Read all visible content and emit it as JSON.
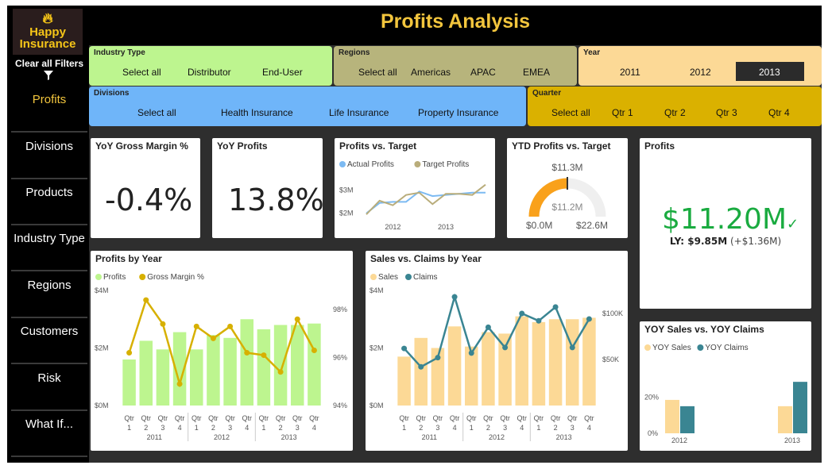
{
  "header": {
    "title": "Profits Analysis"
  },
  "sidebar": {
    "logo_line1": "Happy",
    "logo_line2": "Insurance",
    "clear_filters": "Clear all Filters",
    "items": [
      {
        "label": "Profits"
      },
      {
        "label": "Divisions"
      },
      {
        "label": "Products"
      },
      {
        "label": "Industry Type"
      },
      {
        "label": "Regions"
      },
      {
        "label": "Customers"
      },
      {
        "label": "Risk"
      },
      {
        "label": "What If..."
      }
    ]
  },
  "slicers": {
    "industry": {
      "label": "Industry Type",
      "options": [
        "Select all",
        "Distributor",
        "End-User"
      ]
    },
    "regions": {
      "label": "Regions",
      "options": [
        "Select all",
        "Americas",
        "APAC",
        "EMEA"
      ]
    },
    "year": {
      "label": "Year",
      "options": [
        "2011",
        "2012",
        "2013"
      ],
      "selected": "2013"
    },
    "divisions": {
      "label": "Divisions",
      "options": [
        "Select all",
        "Health Insurance",
        "Life Insurance",
        "Property Insurance"
      ]
    },
    "quarter": {
      "label": "Quarter",
      "options": [
        "Select all",
        "Qtr 1",
        "Qtr 2",
        "Qtr 3",
        "Qtr 4"
      ]
    }
  },
  "kpis": {
    "yoy_gross_margin": {
      "title": "YoY Gross Margin %",
      "value": "-0.4%"
    },
    "yoy_profits": {
      "title": "YoY Profits",
      "value": "13.8%"
    }
  },
  "profits_card": {
    "title": "Profits",
    "value": "$11.20M",
    "ly_label": "LY: $9.85M",
    "ly_delta": "(+$1.36M)"
  },
  "ytd_gauge": {
    "title": "YTD Profits vs. Target",
    "target_label": "$11.3M",
    "value_label": "$11.2M",
    "min_label": "$0.0M",
    "max_label": "$22.6M",
    "value": 11.2,
    "max": 22.6,
    "target": 11.3
  },
  "colors": {
    "profits": "#bdf58f",
    "margin": "#d7b000",
    "sales": "#fcd996",
    "claims": "#3a8592",
    "actual": "#7cbaf2",
    "target": "#b9ad7b",
    "accent": "#f2c53d",
    "green": "#1aab40"
  },
  "chart_data": [
    {
      "id": "profits_vs_target",
      "type": "line",
      "title": "Profits vs. Target",
      "x": [
        "2011 Q3",
        "2011 Q4",
        "2012 Q1",
        "2012 Q2",
        "2012 Q3",
        "2012 Q4",
        "2013 Q1",
        "2013 Q2",
        "2013 Q3",
        "2013 Q4"
      ],
      "x_ticks": [
        "2012",
        "2013"
      ],
      "y_ticks": [
        "$2M",
        "$3M"
      ],
      "ylim": [
        1.7,
        3.5
      ],
      "series": [
        {
          "name": "Actual Profits",
          "values": [
            1.95,
            2.4,
            2.45,
            2.45,
            2.9,
            2.7,
            2.75,
            2.8,
            2.85,
            2.85
          ]
        },
        {
          "name": "Target Profits",
          "values": [
            1.9,
            2.5,
            2.3,
            2.75,
            2.85,
            2.35,
            2.8,
            2.8,
            2.75,
            3.2
          ]
        }
      ]
    },
    {
      "id": "profits_by_year",
      "type": "bar",
      "title": "Profits by Year",
      "categories": [
        "Qtr 1",
        "Qtr 2",
        "Qtr 3",
        "Qtr 4",
        "Qtr 1",
        "Qtr 2",
        "Qtr 3",
        "Qtr 4",
        "Qtr 1",
        "Qtr 2",
        "Qtr 3",
        "Qtr 4"
      ],
      "groups": [
        "2011",
        "2012",
        "2013"
      ],
      "y_ticks": [
        "$4M",
        "$2M",
        "$0M"
      ],
      "y2_ticks": [
        "98%",
        "96%",
        "94%"
      ],
      "ylim": [
        0,
        4
      ],
      "y2lim": [
        94,
        98.8
      ],
      "series": [
        {
          "name": "Profits",
          "values": [
            1.6,
            2.25,
            1.95,
            2.55,
            1.95,
            2.45,
            2.35,
            3.0,
            2.65,
            2.8,
            2.8,
            2.85
          ]
        },
        {
          "name": "Gross Margin %",
          "values": [
            96.2,
            98.4,
            97.4,
            94.9,
            97.3,
            96.8,
            97.3,
            96.2,
            96.1,
            95.4,
            97.6,
            96.3
          ]
        }
      ]
    },
    {
      "id": "sales_vs_claims",
      "type": "bar",
      "title": "Sales vs. Claims by Year",
      "categories": [
        "Qtr 1",
        "Qtr 2",
        "Qtr 3",
        "Qtr 4",
        "Qtr 1",
        "Qtr 2",
        "Qtr 3",
        "Qtr 4",
        "Qtr 1",
        "Qtr 2",
        "Qtr 3",
        "Qtr 4"
      ],
      "groups": [
        "2011",
        "2012",
        "2013"
      ],
      "y_ticks": [
        "$4M",
        "$2M",
        "$0M"
      ],
      "y2_ticks": [
        "$100K",
        "$50K"
      ],
      "ylim": [
        0,
        4
      ],
      "y2lim": [
        0,
        125
      ],
      "series": [
        {
          "name": "Sales",
          "values": [
            1.7,
            2.35,
            2.0,
            2.75,
            2.05,
            2.55,
            2.5,
            3.1,
            2.9,
            3.0,
            3.0,
            3.05
          ]
        },
        {
          "name": "Claims",
          "values": [
            62,
            42,
            52,
            118,
            57,
            85,
            63,
            100,
            92,
            107,
            63,
            94
          ]
        }
      ]
    },
    {
      "id": "yoy_sales_claims",
      "type": "bar",
      "title": "YOY Sales vs. YOY Claims",
      "categories": [
        "2012",
        "2013"
      ],
      "y_ticks": [
        "20%",
        "0%"
      ],
      "ylim": [
        0,
        0.4
      ],
      "series": [
        {
          "name": "YOY Sales",
          "values": [
            0.185,
            0.15
          ]
        },
        {
          "name": "YOY Claims",
          "values": [
            0.15,
            0.285
          ]
        }
      ]
    }
  ]
}
